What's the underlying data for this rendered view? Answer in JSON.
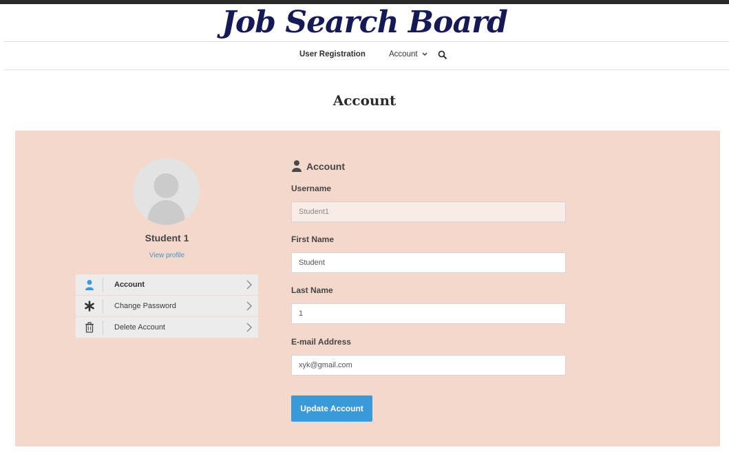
{
  "site": {
    "title": "Job Search Board"
  },
  "nav": {
    "items": [
      {
        "label": "User Registration"
      },
      {
        "label": "Account"
      }
    ],
    "search_icon": "search-icon"
  },
  "page": {
    "title": "Account"
  },
  "profile": {
    "name": "Student 1",
    "view_profile_label": "View profile"
  },
  "menu": {
    "items": [
      {
        "label": "Account",
        "icon": "user-icon",
        "active": true
      },
      {
        "label": "Change Password",
        "icon": "asterisk-icon",
        "active": false
      },
      {
        "label": "Delete Account",
        "icon": "trash-icon",
        "active": false
      }
    ]
  },
  "form": {
    "heading": "Account",
    "username": {
      "label": "Username",
      "value": "Student1"
    },
    "first_name": {
      "label": "First Name",
      "value": "Student"
    },
    "last_name": {
      "label": "Last Name",
      "value": "1"
    },
    "email": {
      "label": "E-mail Address",
      "value": "xyk@gmail.com"
    },
    "submit_label": "Update Account"
  },
  "colors": {
    "title": "#151a56",
    "panel_bg": "#f4d8cb",
    "accent": "#3a9ad9",
    "link": "#4a90c8",
    "menu_bg": "#ececec"
  }
}
